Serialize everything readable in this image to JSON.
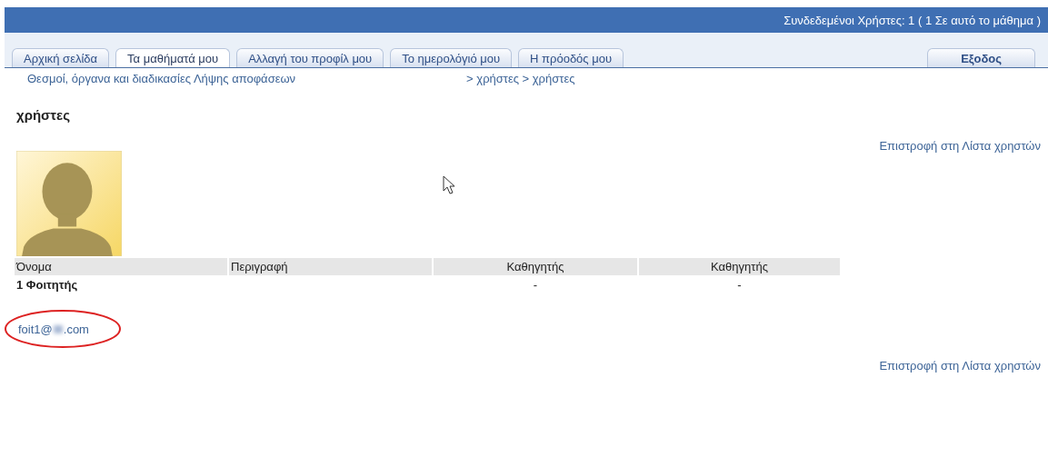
{
  "top_bar": {
    "online_users": "Συνδεδεμένοι Χρήστες:  1  ( 1 Σε αυτό το μάθημα )"
  },
  "tabs": [
    {
      "label": "Αρχική σελίδα",
      "selected": false
    },
    {
      "label": "Τα μαθήματά μου",
      "selected": true
    },
    {
      "label": "Αλλαγή του προφίλ μου",
      "selected": false
    },
    {
      "label": "Το ημερολόγιό μου",
      "selected": false
    },
    {
      "label": "Η πρόοδός μου",
      "selected": false
    }
  ],
  "logout": "Εξοδος",
  "breadcrumb": {
    "course": "Θεσμοί, όργανα και διαδικασίες Λήψης αποφάσεων",
    "path": "> χρήστες > χρήστες"
  },
  "heading": "χρήστες",
  "back_link_top": "Επιστροφή στη Λίστα χρηστών",
  "table": {
    "columns": [
      {
        "label": "Όνομα"
      },
      {
        "label": "Περιγραφή"
      },
      {
        "label": "Καθηγητής"
      },
      {
        "label": "Καθηγητής"
      }
    ],
    "rows": [
      [
        "1 Φοιτητής",
        "",
        "-",
        "-"
      ]
    ]
  },
  "email": {
    "prefix": "foit1@",
    "suffix": ".com",
    "circled": true
  },
  "back_link_bottom": "Επιστροφή στη Λίστα χρηστών"
}
